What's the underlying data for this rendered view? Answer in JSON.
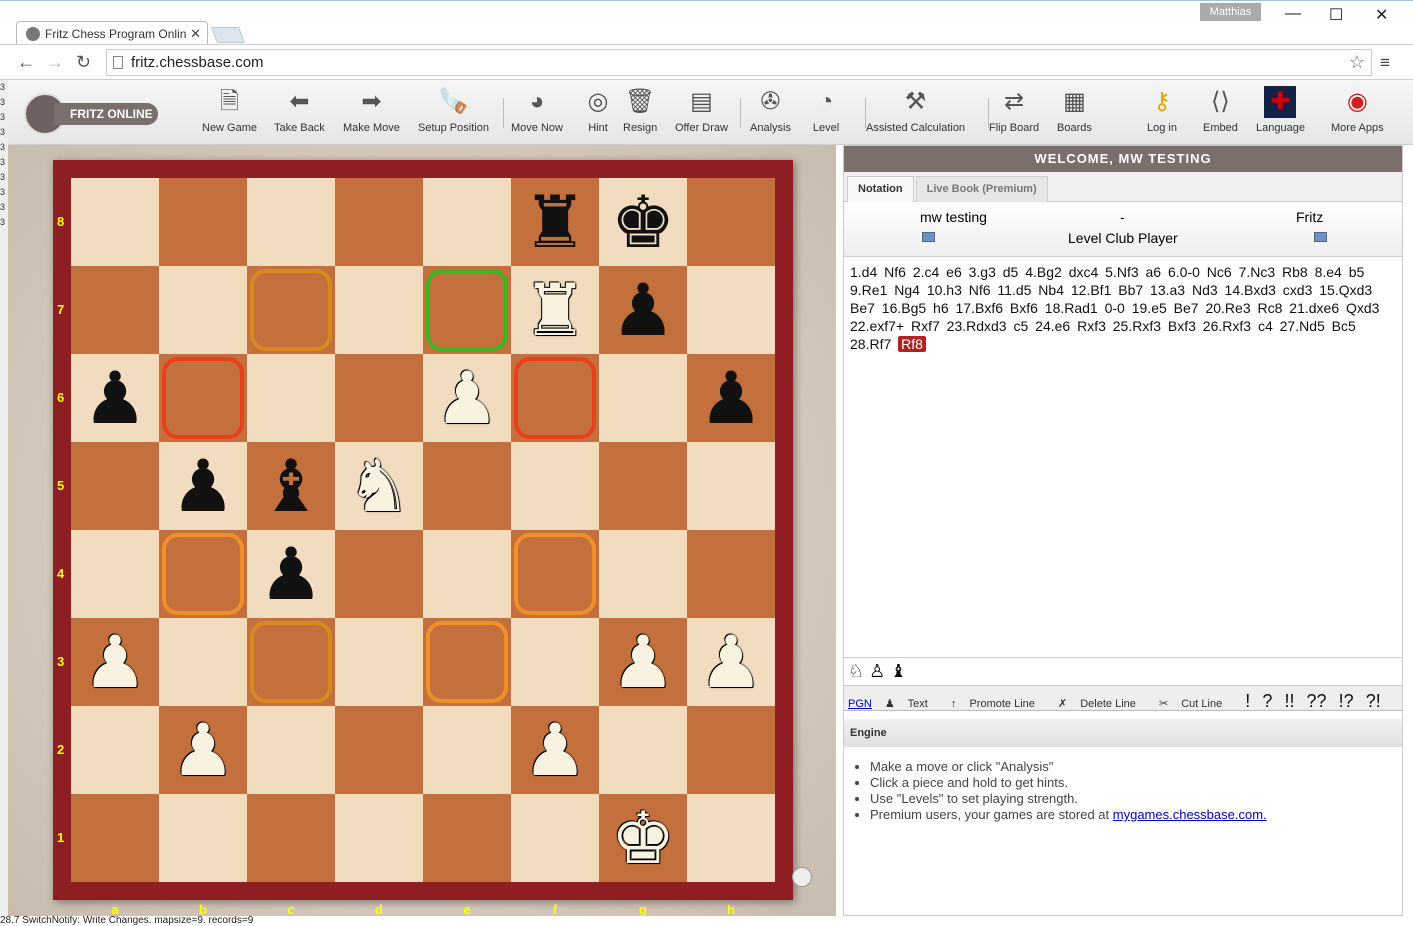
{
  "browser": {
    "tab_title": "Fritz Chess Program Onlin",
    "profile": "Matthias",
    "url": "fritz.chessbase.com"
  },
  "toolbar": {
    "logo": "FRITZ ONLINE",
    "items": [
      {
        "label": "New Game",
        "icon": "new-document-icon"
      },
      {
        "label": "Take Back",
        "icon": "arrow-left-icon"
      },
      {
        "label": "Make Move",
        "icon": "arrow-right-icon"
      },
      {
        "label": "Setup Position",
        "icon": "saw-icon"
      },
      {
        "label": "Move Now",
        "icon": "whistle-icon"
      },
      {
        "label": "Hint",
        "icon": "lifebuoy-icon"
      },
      {
        "label": "Resign",
        "icon": "trash-icon"
      },
      {
        "label": "Offer Draw",
        "icon": "draw-icon"
      },
      {
        "label": "Analysis",
        "icon": "fan-icon"
      },
      {
        "label": "Level",
        "icon": "gauge-icon"
      },
      {
        "label": "Assisted Calculation",
        "icon": "grip-icon"
      },
      {
        "label": "Flip Board",
        "icon": "flip-board-icon"
      },
      {
        "label": "Boards",
        "icon": "boards-icon"
      },
      {
        "label": "Log in",
        "icon": "key-icon"
      },
      {
        "label": "Embed",
        "icon": "embed-icon"
      },
      {
        "label": "Language",
        "icon": "uk-flag-icon"
      },
      {
        "label": "More Apps",
        "icon": "apps-icon"
      }
    ]
  },
  "board": {
    "ranks": [
      "8",
      "7",
      "6",
      "5",
      "4",
      "3",
      "2",
      "1"
    ],
    "files": [
      "a",
      "b",
      "c",
      "d",
      "e",
      "f",
      "g",
      "h"
    ],
    "position": [
      "5rk1",
      "5Rp1",
      "p3P2p",
      "1pbN4",
      "2p5",
      "P5PP",
      "1P3P2",
      "6K1"
    ],
    "highlights": [
      {
        "square": "c7",
        "color": "#d9891f"
      },
      {
        "square": "e7",
        "color": "#3cb521"
      },
      {
        "square": "b6",
        "color": "#e8401c"
      },
      {
        "square": "f6",
        "color": "#e8401c"
      },
      {
        "square": "b4",
        "color": "#f0902a"
      },
      {
        "square": "f4",
        "color": "#f0902a"
      },
      {
        "square": "c3",
        "color": "#d9891f"
      },
      {
        "square": "e3",
        "color": "#f0902a"
      }
    ]
  },
  "console": "28.7  SwitchNotify: Write Changes. mapsize=9. records=9",
  "panel": {
    "welcome": "WELCOME, MW TESTING",
    "tabs": [
      "Notation",
      "Live Book (Premium)"
    ],
    "white": "mw testing",
    "separator": "-",
    "black": "Fritz",
    "level": "Level Club Player",
    "moves": "1.d4 Nf6 2.c4 e6 3.g3 d5 4.Bg2 dxc4 5.Nf3 a6 6.0-0 Nc6 7.Nc3 Rb8 8.e4 b5 9.Re1 Ng4 10.h3 Nf6 11.d5 Nb4 12.Bf1 Bb7 13.a3 Nd3 14.Bxd3 cxd3 15.Qxd3 Be7 16.Bg5 h6 17.Bxf6 Bxf6 18.Rad1 0-0 19.e5 Be7 20.Re3 Rc8 21.dxe6 Qxd3 22.exf7+ Rxf7 23.Rdxd3 c5 24.e6 Rxf3 25.Rxf3 Bxf3 26.Rxf3 c4 27.Nd5 Bc5 28.Rf7",
    "current_move": "Rf8",
    "edit_tools": {
      "pgn": "PGN",
      "text": "Text",
      "promote": "Promote Line",
      "delete": "Delete Line",
      "cut": "Cut Line",
      "symbols": [
        "!",
        "?",
        "!!",
        "??",
        "!?",
        "?!"
      ]
    },
    "engine_title": "Engine",
    "engine_tips": [
      "Make a move or click \"Analysis\"",
      "Click a piece and hold to get hints.",
      "Use \"Levels\" to set playing strength.",
      "Premium users, your games are stored at "
    ],
    "engine_link": "mygames.chessbase.com."
  }
}
